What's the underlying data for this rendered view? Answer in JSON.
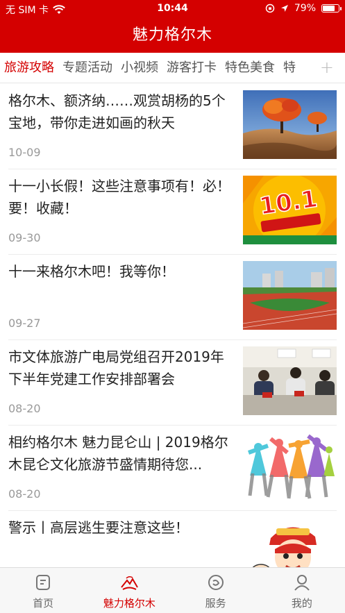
{
  "status_bar": {
    "carrier": "无 SIM 卡",
    "time": "10:44",
    "battery": "79%",
    "battery_level": 0.79
  },
  "header": {
    "title": "魅力格尔木"
  },
  "tabs": [
    {
      "label": "旅游攻略",
      "active": true
    },
    {
      "label": "专题活动",
      "active": false
    },
    {
      "label": "小视频",
      "active": false
    },
    {
      "label": "游客打卡",
      "active": false
    },
    {
      "label": "特色美食",
      "active": false
    },
    {
      "label": "特",
      "active": false
    }
  ],
  "add_tab_icon": "plus-icon",
  "articles": [
    {
      "title": "格尔木、额济纳……观赏胡杨的5个宝地，带你走进如画的秋天",
      "date": "10-09",
      "image": "autumn-poplar-trees"
    },
    {
      "title": "十一小长假！这些注意事项有！必！要！收藏！",
      "date": "09-30",
      "image": "holiday-10-1-poster",
      "image_text": "10.1"
    },
    {
      "title": "十一来格尔木吧！我等你！",
      "date": "09-27",
      "image": "stadium-track"
    },
    {
      "title": "市文体旅游广电局党组召开2019年下半年党建工作安排部署会",
      "date": "08-20",
      "image": "meeting-room"
    },
    {
      "title": "相约格尔木 魅力昆仑山 | 2019格尔木昆仑文化旅游节盛情期待您...",
      "date": "08-20",
      "image": "dancing-silhouettes"
    },
    {
      "title": "警示丨高层逃生要注意这些！",
      "date": "",
      "image": "firefighter-cartoon"
    }
  ],
  "bottom_tabs": [
    {
      "label": "首页",
      "icon": "home-icon",
      "active": false
    },
    {
      "label": "魅力格尔木",
      "icon": "mountain-icon",
      "active": true
    },
    {
      "label": "服务",
      "icon": "service-icon",
      "active": false
    },
    {
      "label": "我的",
      "icon": "profile-icon",
      "active": false
    }
  ],
  "colors": {
    "brand_red": "#d40000",
    "inactive_gray": "#666666",
    "date_gray": "#999999"
  }
}
